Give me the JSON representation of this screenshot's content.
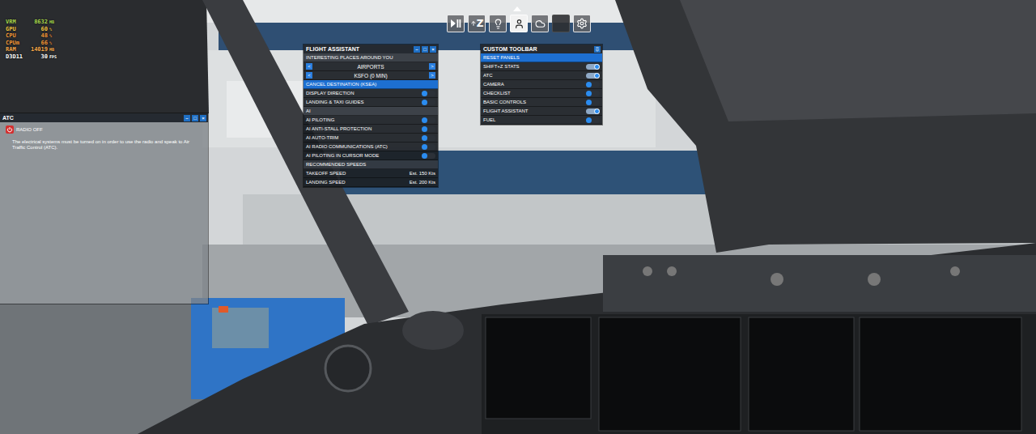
{
  "perf_overlay": {
    "stats": [
      {
        "label": "VRM",
        "value": "8632",
        "unit": "MB",
        "color": "#a8d84e"
      },
      {
        "label": "GPU",
        "value": "60",
        "unit": "%",
        "color": "#f2c744"
      },
      {
        "label": "CPU",
        "value": "48",
        "unit": "%",
        "color": "#f39a3a"
      },
      {
        "label": "CPUm",
        "value": "66",
        "unit": "%",
        "color": "#f39a3a"
      },
      {
        "label": "RAM",
        "value": "14019",
        "unit": "MB",
        "color": "#f5a84a"
      },
      {
        "label": "D3D11",
        "value": "30",
        "unit": "FPS",
        "color": "#ffffff"
      }
    ]
  },
  "toolbar": {
    "expanded": true,
    "buttons": [
      {
        "kind": "pause",
        "selected": false
      },
      {
        "kind": "stats",
        "label": "Z",
        "selected": false
      },
      {
        "kind": "assistant",
        "selected": false
      },
      {
        "kind": "atc",
        "selected": true
      },
      {
        "kind": "weather",
        "selected": false
      },
      {
        "kind": "blank",
        "selected": false
      },
      {
        "kind": "settings",
        "selected": false
      }
    ]
  },
  "flight_assistant": {
    "title": "FLIGHT ASSISTANT",
    "controls": [
      "–",
      "□",
      "×"
    ],
    "rows": [
      {
        "kind": "header",
        "label": "INTERESTING PLACES AROUND YOU"
      },
      {
        "kind": "selector",
        "label": "AIRPORTS",
        "prev": "<",
        "next": ">"
      },
      {
        "kind": "selector",
        "label": "KSFO (0 MIN)",
        "prev": "<",
        "next": ">"
      },
      {
        "kind": "action",
        "label": "CANCEL DESTINATION (KSEA)",
        "selected": true
      },
      {
        "kind": "toggle",
        "label": "DISPLAY DIRECTION",
        "on": false
      },
      {
        "kind": "toggle",
        "label": "LANDING & TAXI GUIDES",
        "on": false
      },
      {
        "kind": "header",
        "label": "AI"
      },
      {
        "kind": "toggle",
        "label": "AI PILOTING",
        "on": false
      },
      {
        "kind": "toggle",
        "label": "AI ANTI-STALL PROTECTION",
        "on": false
      },
      {
        "kind": "toggle",
        "label": "AI AUTO-TRIM",
        "on": false
      },
      {
        "kind": "toggle",
        "label": "AI RADIO COMMUNICATIONS (ATC)",
        "on": false
      },
      {
        "kind": "toggle",
        "label": "AI PILOTING IN CURSOR MODE",
        "on": false
      },
      {
        "kind": "header",
        "label": "RECOMMENDED SPEEDS"
      },
      {
        "kind": "reading",
        "label": "TAKEOFF SPEED",
        "value": "Est. 150 Kts"
      },
      {
        "kind": "reading",
        "label": "LANDING SPEED",
        "value": "Est. 200 Kts"
      }
    ]
  },
  "custom_toolbar": {
    "title": "CUSTOM TOOLBAR",
    "rows": [
      {
        "kind": "action",
        "label": "RESET PANELS",
        "selected": true
      },
      {
        "kind": "toggle",
        "label": "SHIFT+Z STATS",
        "on": true
      },
      {
        "kind": "toggle",
        "label": "ATC",
        "on": true
      },
      {
        "kind": "toggle",
        "label": "CAMERA",
        "on": false
      },
      {
        "kind": "toggle",
        "label": "CHECKLIST",
        "on": false
      },
      {
        "kind": "toggle",
        "label": "BASIC CONTROLS",
        "on": false
      },
      {
        "kind": "toggle",
        "label": "FLIGHT ASSISTANT",
        "on": true
      },
      {
        "kind": "toggle",
        "label": "FUEL",
        "on": false
      }
    ]
  },
  "atc": {
    "title": "ATC",
    "controls": [
      "–",
      "□",
      "×"
    ],
    "status": "RADIO OFF",
    "message": "The electrical systems must be turned on in order to use the radio and speak to Air Traffic Control (ATC)."
  }
}
